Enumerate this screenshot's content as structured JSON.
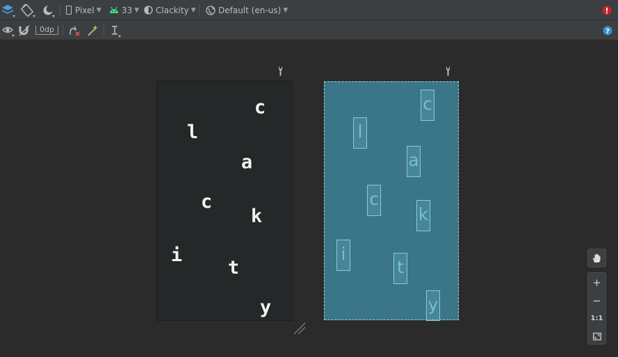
{
  "toolbar": {
    "device": "Pixel",
    "api_level": "33",
    "theme": "Clackity",
    "locale": "Default (en-us)",
    "margin": "0dp"
  },
  "design_letters": [
    "c",
    "l",
    "a",
    "c",
    "k",
    "i",
    "t",
    "y"
  ],
  "blueprint_letters": [
    "c",
    "l",
    "a",
    "c",
    "k",
    "i",
    "t",
    "y"
  ],
  "zoom": {
    "zoom_in": "+",
    "zoom_out": "−",
    "actual_size": "1:1"
  },
  "colors": {
    "accent_blue": "#3a7588",
    "error_red": "#c7222a",
    "help_blue": "#3592c4",
    "android_green": "#3ddc84"
  }
}
